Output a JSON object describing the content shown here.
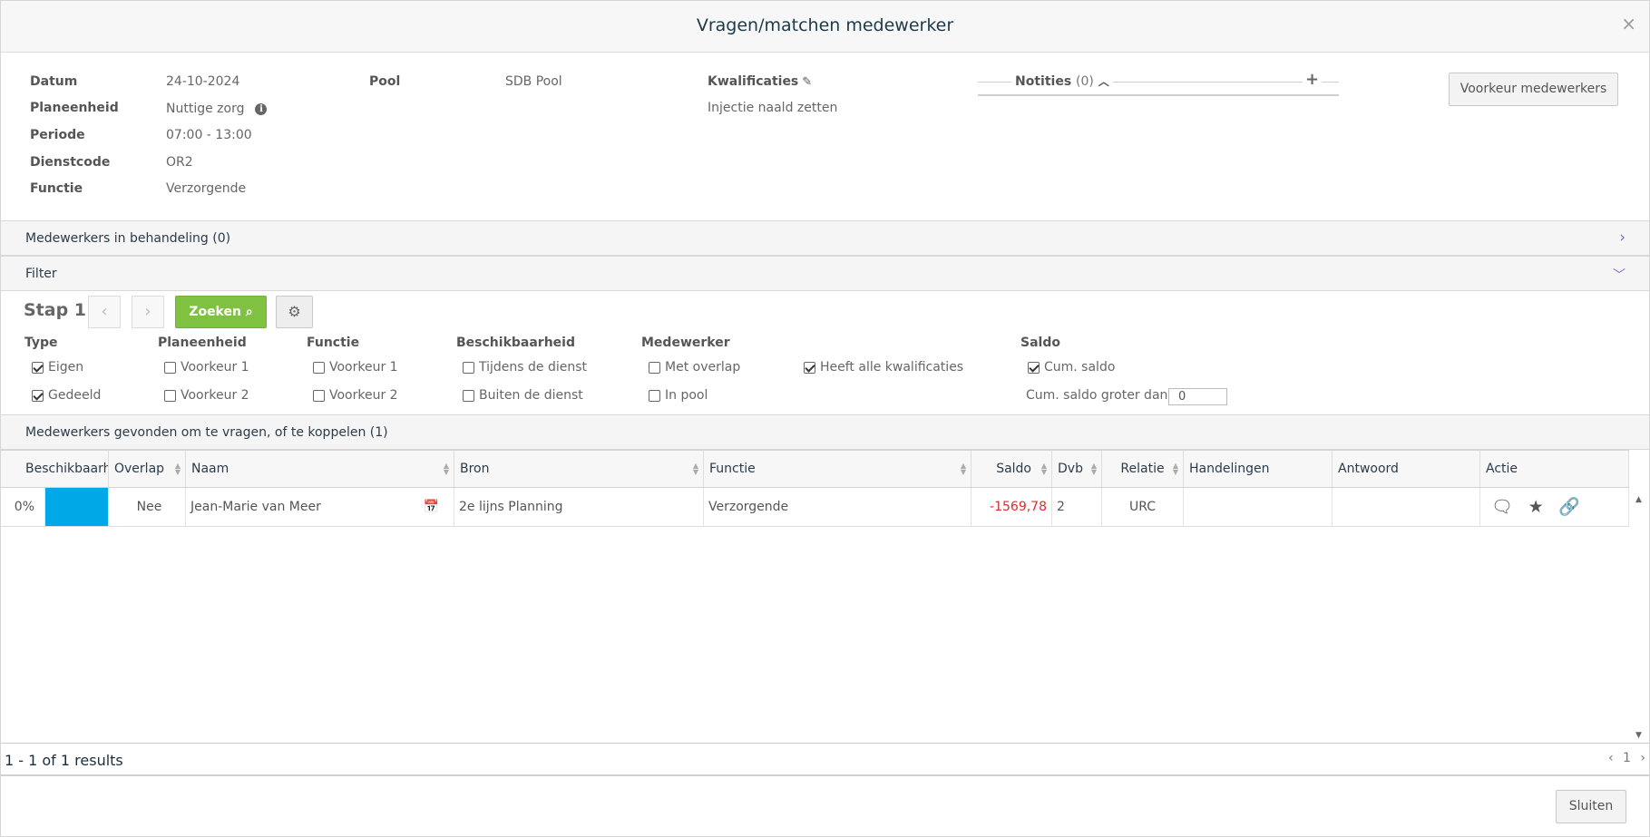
{
  "dialog": {
    "title": "Vragen/matchen medewerker",
    "close": "×"
  },
  "details": {
    "datum_label": "Datum",
    "datum": "24-10-2024",
    "planeenheid_label": "Planeenheid",
    "planeenheid": "Nuttige zorg",
    "periode_label": "Periode",
    "periode": "07:00 - 13:00",
    "dienstcode_label": "Dienstcode",
    "dienstcode": "OR2",
    "functie_label": "Functie",
    "functie": "Verzorgende",
    "pool_label": "Pool",
    "pool": "SDB Pool",
    "kwalificaties_label": "Kwalificaties",
    "kwalificaties": "Injectie naald zetten"
  },
  "notes": {
    "title": "Notities",
    "count": "(0)"
  },
  "voorkeur_button": "Voorkeur medewerkers",
  "sections": {
    "in_behandeling": "Medewerkers in behandeling (0)",
    "filter": "Filter",
    "gevonden": "Medewerkers gevonden om te vragen, of te koppelen (1)"
  },
  "filter": {
    "step": "Stap 1",
    "search_label": "Zoeken",
    "groups": {
      "type": "Type",
      "planeenheid": "Planeenheid",
      "functie": "Functie",
      "beschikbaarheid": "Beschikbaarheid",
      "medewerker": "Medewerker",
      "saldo": "Saldo"
    },
    "options": {
      "eigen": "Eigen",
      "gedeeld": "Gedeeld",
      "plan_v1": "Voorkeur 1",
      "plan_v2": "Voorkeur 2",
      "func_v1": "Voorkeur 1",
      "func_v2": "Voorkeur 2",
      "tijdens": "Tijdens de dienst",
      "buiten": "Buiten de dienst",
      "overlap": "Met overlap",
      "inpool": "In pool",
      "kwal": "Heeft alle kwalificaties",
      "cumsaldo": "Cum. saldo",
      "cumgroter": "Cum. saldo groter dan",
      "cumgroter_value": "0"
    }
  },
  "table": {
    "columns": [
      "Beschikbaarh",
      "Overlap",
      "Naam",
      "Bron",
      "Functie",
      "Saldo",
      "Dvb",
      "Relatie",
      "Handelingen",
      "Antwoord",
      "Actie"
    ],
    "rows": [
      {
        "beschikbaar": "0%",
        "bar_color": "#00a8e8",
        "overlap": "Nee",
        "naam": "Jean-Marie van Meer",
        "bron": "2e lijns Planning",
        "functie": "Verzorgende",
        "saldo": "-1569,78",
        "dvb": "2",
        "relatie": "URC",
        "handelingen": "",
        "antwoord": ""
      }
    ]
  },
  "pager": {
    "results": "1 - 1 of 1 results",
    "page": "1"
  },
  "close_button": "Sluiten"
}
